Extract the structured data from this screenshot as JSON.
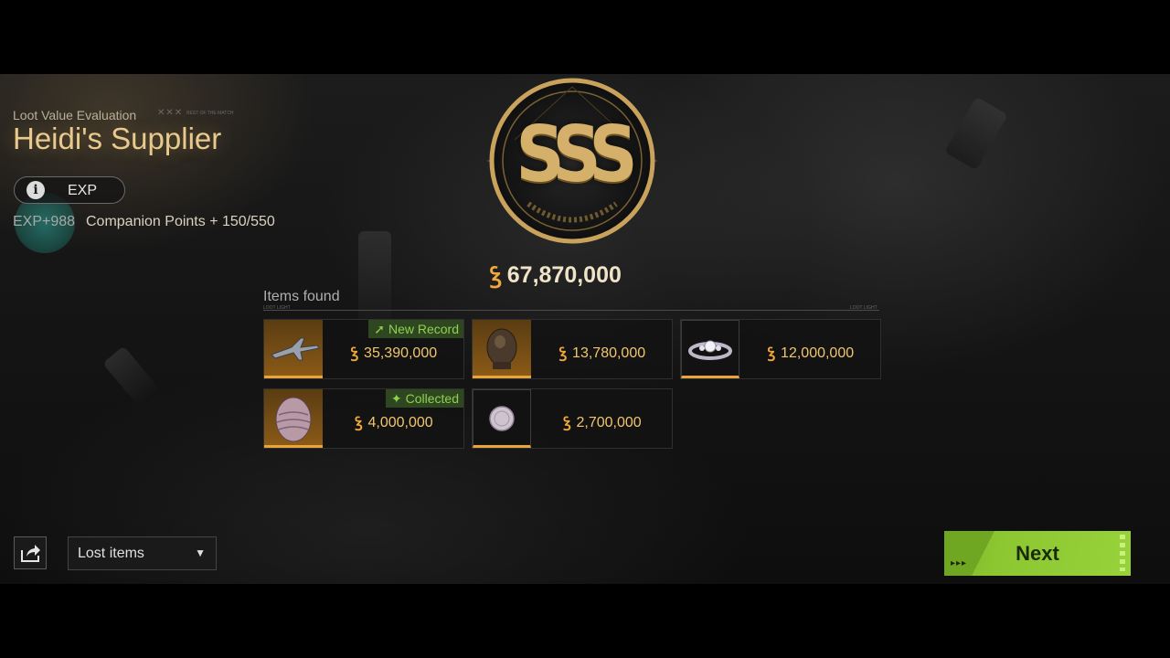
{
  "header": {
    "eval_label": "Loot Value Evaluation",
    "best_mark_text": "BEST OF THE MATCH",
    "title": "Heidi's Supplier"
  },
  "exp_panel": {
    "button_label": "EXP",
    "exp_gain": "EXP+988",
    "companion_points": "Companion Points + 150/550"
  },
  "rating": {
    "grade": "SSS",
    "total_value": "67,870,000"
  },
  "items_found": {
    "label": "Items found",
    "rule_left_tag": "LOOT LIGHT",
    "rule_right_tag": "LOOT LIGHT",
    "items": [
      {
        "name": "fighter-jet",
        "price": "35,390,000",
        "badge": "New Record",
        "badge_icon": "arrow-up-right-icon"
      },
      {
        "name": "statue-bust",
        "price": "13,780,000",
        "badge": "",
        "badge_icon": ""
      },
      {
        "name": "diamond-ring",
        "price": "12,000,000",
        "badge": "",
        "badge_icon": ""
      },
      {
        "name": "jeweled-egg",
        "price": "4,000,000",
        "badge": "Collected",
        "badge_icon": "sparkle-icon"
      },
      {
        "name": "coin",
        "price": "2,700,000",
        "badge": "",
        "badge_icon": ""
      }
    ]
  },
  "footer": {
    "filter_value": "Lost items",
    "next_label": "Next"
  },
  "colors": {
    "gold_text": "#e8c98e",
    "price_text": "#f1c66e",
    "accent_green": "#8cc731",
    "badge_green": "#8ed14f",
    "rarity_orange": "#e9a43a"
  }
}
